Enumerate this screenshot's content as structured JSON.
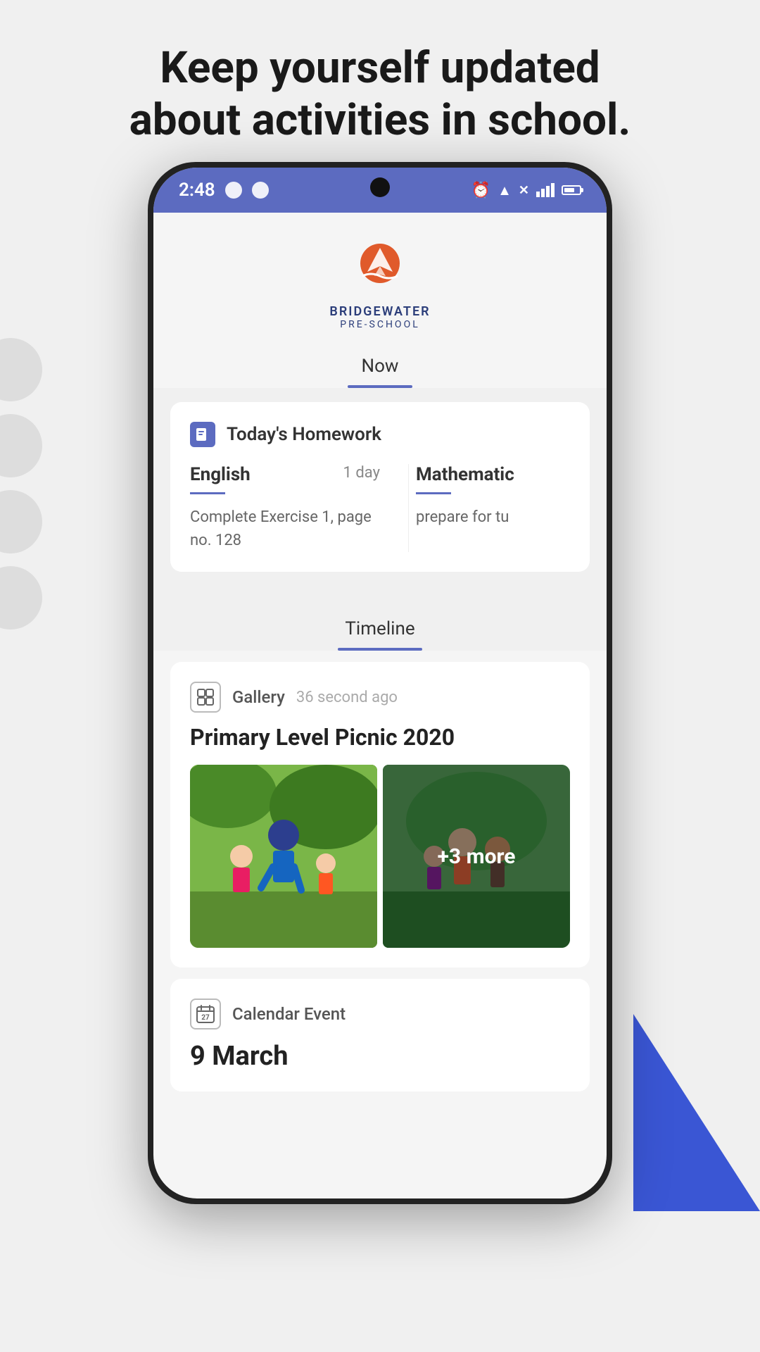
{
  "page": {
    "headline_line1": "Keep yourself updated",
    "headline_line2": "about activities in school."
  },
  "status_bar": {
    "time": "2:48",
    "icons_left": [
      "maps-icon",
      "whatsapp-icon"
    ],
    "icons_right": [
      "alarm-icon",
      "wifi-icon",
      "signal-icon",
      "battery-icon"
    ]
  },
  "school": {
    "name": "BRIDGEWATER",
    "subtitle": "PRE-SCHOOL"
  },
  "tabs_top": {
    "items": [
      {
        "label": "Now",
        "active": true
      }
    ]
  },
  "homework": {
    "card_title": "Today's Homework",
    "subjects": [
      {
        "name": "English",
        "due": "1 day",
        "underline": true,
        "description": "Complete Exercise 1, page no. 128"
      },
      {
        "name": "Mathematic",
        "due": "",
        "underline": true,
        "description": "prepare for tu"
      }
    ]
  },
  "timeline": {
    "tab_label": "Timeline",
    "gallery_post": {
      "type": "Gallery",
      "time_ago": "36 second ago",
      "title": "Primary Level Picnic 2020",
      "more_count": "+3 more"
    },
    "calendar_post": {
      "type": "Calendar Event",
      "icon_number": "27",
      "date": "9 March"
    }
  }
}
